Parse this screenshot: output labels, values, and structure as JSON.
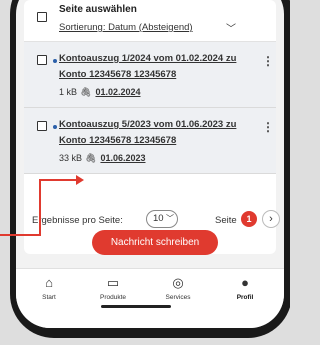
{
  "list": {
    "select_all_label": "Seite auswählen",
    "sort_label": "Sortierung: Datum (Absteigend)",
    "documents": [
      {
        "title": "Kontoauszug 1/2024 vom 01.02.2024 zu Konto 12345678 12345678",
        "size": "1 kB",
        "date": "01.02.2024"
      },
      {
        "title": "Kontoauszug 5/2023 vom 01.06.2023 zu Konto 12345678 12345678",
        "size": "33 kB",
        "date": "01.06.2023"
      }
    ]
  },
  "pagination": {
    "results_label": "Ergebnisse pro Seite:",
    "results_value": "10",
    "page_label": "Seite",
    "current_page": "1"
  },
  "cta": {
    "label": "Nachricht schreiben"
  },
  "tabs": [
    {
      "label": "Start",
      "icon": "home-icon"
    },
    {
      "label": "Produkte",
      "icon": "products-icon"
    },
    {
      "label": "Services",
      "icon": "services-icon"
    },
    {
      "label": "Profil",
      "icon": "profile-icon"
    }
  ],
  "colors": {
    "accent": "#e03a2f",
    "link_dot": "#2b5fa8"
  }
}
